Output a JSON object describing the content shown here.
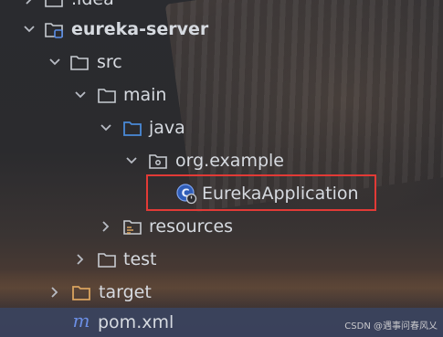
{
  "tree": {
    "items": [
      {
        "label": ".idea"
      },
      {
        "label": "eureka-server"
      },
      {
        "label": "src"
      },
      {
        "label": "main"
      },
      {
        "label": "java"
      },
      {
        "label": "org.example"
      },
      {
        "label": "EurekaApplication"
      },
      {
        "label": "resources"
      },
      {
        "label": "test"
      },
      {
        "label": "target"
      },
      {
        "label": "pom.xml"
      }
    ]
  },
  "icons": {
    "folder": "folder-icon",
    "module": "module-folder-icon",
    "source_root": "source-folder-icon",
    "package": "package-icon",
    "resources": "resources-folder-icon",
    "excluded": "excluded-folder-icon",
    "spring_boot_app": "spring-boot-application-icon",
    "maven": "maven-icon"
  },
  "colors": {
    "selection": "#3a4462",
    "highlight_border": "#e23a36",
    "java_folder": "#4a8ad8",
    "target_folder": "#d9a35f",
    "maven_m": "#6c8fe6"
  },
  "watermark": "CSDN @遇事问春风乂"
}
